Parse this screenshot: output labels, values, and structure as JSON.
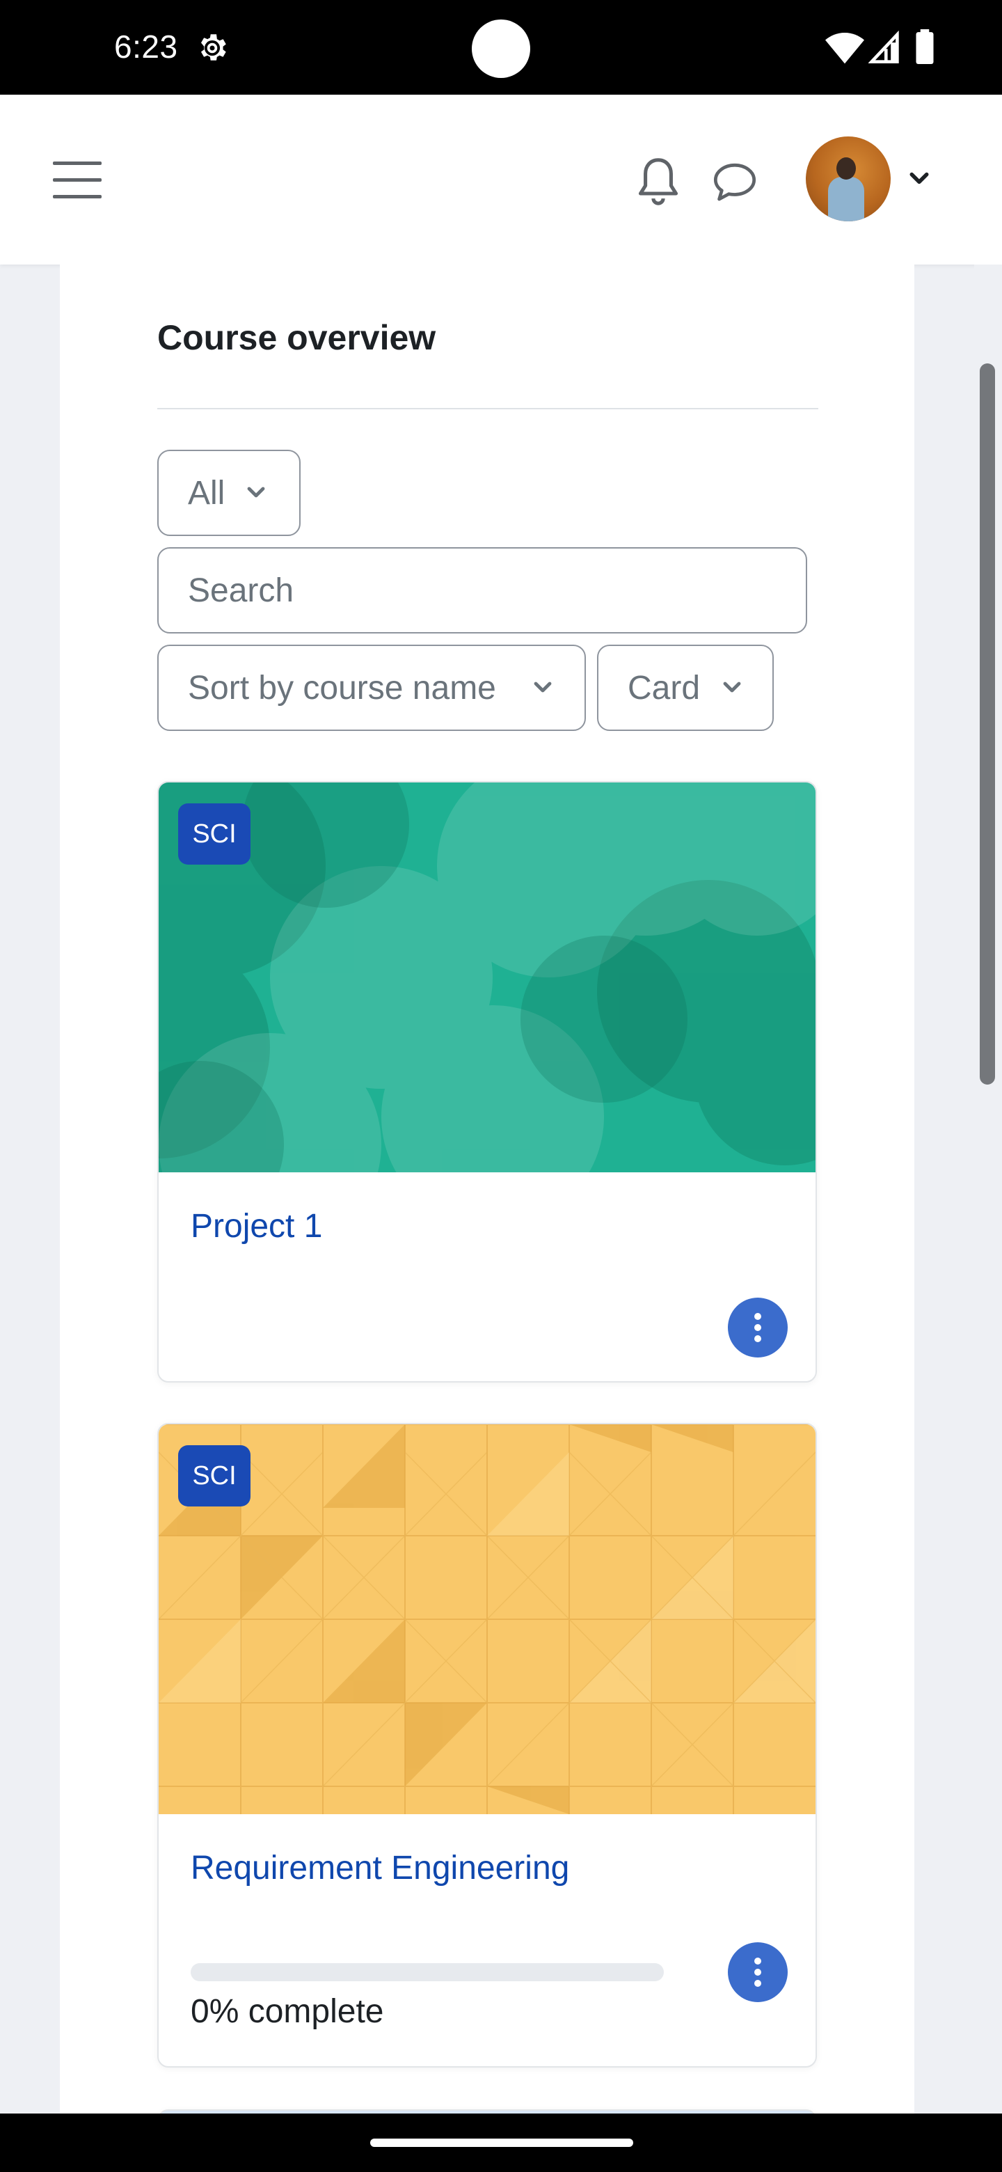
{
  "status_bar": {
    "time": "6:23",
    "icons": [
      "settings-gear-icon",
      "wifi-icon",
      "cell-signal-icon",
      "battery-icon"
    ]
  },
  "header": {
    "menu_icon": "hamburger-menu-icon",
    "notifications_icon": "bell-icon",
    "messages_icon": "chat-bubble-icon",
    "user_menu_icon": "chevron-down-icon"
  },
  "course_overview": {
    "title": "Course overview",
    "filter": {
      "selected": "All"
    },
    "search": {
      "placeholder": "Search",
      "value": ""
    },
    "sort": {
      "selected": "Sort by course name"
    },
    "view": {
      "selected": "Card"
    }
  },
  "courses": [
    {
      "category": "SCI",
      "name": "Project 1",
      "image_color": "#1fb193",
      "show_progress": false
    },
    {
      "category": "SCI",
      "name": "Requirement Engineering",
      "image_color": "#f9c86a",
      "show_progress": true,
      "progress_percent": 0,
      "progress_label": "0% complete"
    }
  ],
  "colors": {
    "link": "#0f47ad",
    "badge": "#1a4ab5",
    "menu_button": "#3b6ccc"
  }
}
